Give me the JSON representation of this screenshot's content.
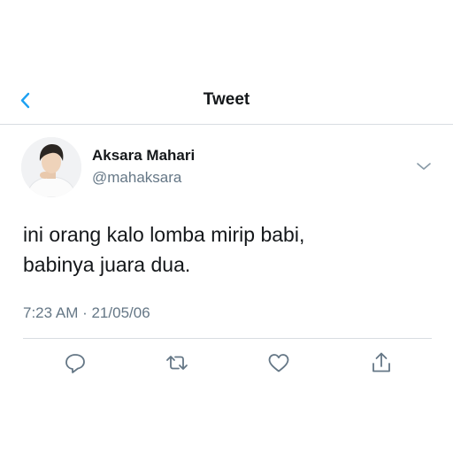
{
  "header": {
    "title": "Tweet",
    "back_icon": "chevron-left-icon"
  },
  "tweet": {
    "author": {
      "display_name": "Aksara Mahari",
      "handle": "@mahaksara",
      "avatar_icon": "avatar"
    },
    "more_icon": "chevron-down-icon",
    "text_lines": [
      "ini orang kalo lomba mirip babi,",
      "babinya juara dua."
    ],
    "timestamp": "7:23 AM · 21/05/06"
  },
  "actions": [
    {
      "icon": "reply-icon"
    },
    {
      "icon": "retweet-icon"
    },
    {
      "icon": "like-icon"
    },
    {
      "icon": "share-icon"
    }
  ],
  "colors": {
    "accent": "#1da1f2",
    "text_primary": "#14171a",
    "text_secondary": "#657786",
    "icon_gray": "#657786",
    "divider": "#d8dde1"
  }
}
